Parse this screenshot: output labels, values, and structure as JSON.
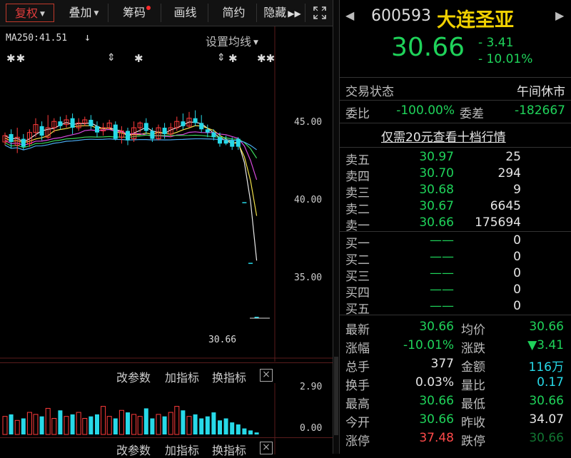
{
  "toolbar": {
    "fuquan": "复权",
    "diejia": "叠加",
    "chouma": "筹码",
    "huaxian": "画线",
    "jianyue": "简约",
    "yincang": "隐藏"
  },
  "chart": {
    "ma250": "MA250:41.51",
    "settings_label": "设置均线",
    "price_axis": [
      "45.00",
      "40.00",
      "35.00"
    ],
    "last_price_label": "30.66",
    "sub_axis": [
      "2.90",
      "0.00"
    ],
    "sub_toolbar": {
      "change_params": "改参数",
      "add_indicator": "加指标",
      "switch_indicator": "换指标"
    },
    "sub_toolbar2": {
      "change_params": "改参数",
      "add_indicator": "加指标",
      "switch_indicator": "换指标"
    },
    "candles": [
      {
        "o": 41.7,
        "c": 42.1,
        "h": 42.3,
        "l": 41.5,
        "up": true
      },
      {
        "o": 42.2,
        "c": 41.7,
        "h": 42.5,
        "l": 41.3,
        "up": false
      },
      {
        "o": 41.5,
        "c": 42.0,
        "h": 42.6,
        "l": 41.0,
        "up": true
      },
      {
        "o": 41.9,
        "c": 41.4,
        "h": 42.2,
        "l": 41.2,
        "up": false
      },
      {
        "o": 41.6,
        "c": 42.3,
        "h": 42.5,
        "l": 41.4,
        "up": true
      },
      {
        "o": 42.3,
        "c": 42.8,
        "h": 43.2,
        "l": 42.0,
        "up": true
      },
      {
        "o": 42.7,
        "c": 42.1,
        "h": 43.0,
        "l": 41.8,
        "up": false
      },
      {
        "o": 42.0,
        "c": 42.6,
        "h": 43.4,
        "l": 41.9,
        "up": true
      },
      {
        "o": 42.6,
        "c": 43.0,
        "h": 43.2,
        "l": 42.3,
        "up": true
      },
      {
        "o": 43.0,
        "c": 42.7,
        "h": 43.3,
        "l": 42.5,
        "up": false
      },
      {
        "o": 42.8,
        "c": 43.1,
        "h": 43.4,
        "l": 42.6,
        "up": true
      },
      {
        "o": 43.2,
        "c": 42.6,
        "h": 43.5,
        "l": 42.2,
        "up": false
      },
      {
        "o": 42.6,
        "c": 42.9,
        "h": 43.2,
        "l": 42.4,
        "up": true
      },
      {
        "o": 42.9,
        "c": 43.1,
        "h": 43.3,
        "l": 42.7,
        "up": true
      },
      {
        "o": 43.1,
        "c": 42.7,
        "h": 43.4,
        "l": 42.5,
        "up": false
      },
      {
        "o": 42.7,
        "c": 42.3,
        "h": 43.0,
        "l": 42.0,
        "up": false
      },
      {
        "o": 42.4,
        "c": 42.6,
        "h": 42.9,
        "l": 42.1,
        "up": true
      },
      {
        "o": 42.6,
        "c": 42.9,
        "h": 43.1,
        "l": 42.5,
        "up": true
      },
      {
        "o": 42.8,
        "c": 41.9,
        "h": 43.0,
        "l": 41.8,
        "up": false
      },
      {
        "o": 42.0,
        "c": 42.4,
        "h": 42.7,
        "l": 41.6,
        "up": true
      },
      {
        "o": 42.4,
        "c": 41.8,
        "h": 42.6,
        "l": 41.5,
        "up": false
      },
      {
        "o": 41.9,
        "c": 42.6,
        "h": 43.0,
        "l": 41.7,
        "up": true
      },
      {
        "o": 42.6,
        "c": 42.9,
        "h": 43.0,
        "l": 42.3,
        "up": true
      },
      {
        "o": 42.9,
        "c": 42.4,
        "h": 43.2,
        "l": 42.2,
        "up": false
      },
      {
        "o": 42.4,
        "c": 41.9,
        "h": 42.6,
        "l": 41.7,
        "up": false
      },
      {
        "o": 41.9,
        "c": 42.6,
        "h": 42.8,
        "l": 41.8,
        "up": true
      },
      {
        "o": 42.6,
        "c": 42.2,
        "h": 42.9,
        "l": 41.9,
        "up": false
      },
      {
        "o": 42.2,
        "c": 42.6,
        "h": 42.9,
        "l": 42.0,
        "up": true
      },
      {
        "o": 42.6,
        "c": 43.0,
        "h": 43.3,
        "l": 42.4,
        "up": true
      },
      {
        "o": 43.0,
        "c": 42.7,
        "h": 43.5,
        "l": 42.5,
        "up": false
      },
      {
        "o": 42.7,
        "c": 43.2,
        "h": 43.6,
        "l": 42.6,
        "up": true
      },
      {
        "o": 43.2,
        "c": 42.9,
        "h": 43.7,
        "l": 42.7,
        "up": false
      },
      {
        "o": 42.9,
        "c": 42.5,
        "h": 43.4,
        "l": 42.3,
        "up": false
      },
      {
        "o": 42.5,
        "c": 42.3,
        "h": 42.8,
        "l": 42.0,
        "up": false
      },
      {
        "o": 42.3,
        "c": 42.0,
        "h": 42.5,
        "l": 41.8,
        "up": false
      },
      {
        "o": 42.0,
        "c": 41.6,
        "h": 42.3,
        "l": 41.4,
        "up": false
      },
      {
        "o": 41.6,
        "c": 41.8,
        "h": 42.1,
        "l": 41.5,
        "up": false
      },
      {
        "o": 41.8,
        "c": 41.4,
        "h": 42.0,
        "l": 41.2,
        "up": false
      },
      {
        "o": 41.4,
        "c": 41.9,
        "h": 42.0,
        "l": 41.2,
        "up": false
      },
      {
        "o": 37.9,
        "c": 37.9,
        "h": 37.9,
        "l": 37.9,
        "up": false
      },
      {
        "o": 34.07,
        "c": 34.07,
        "h": 34.07,
        "l": 34.07,
        "up": false
      },
      {
        "o": 30.66,
        "c": 30.66,
        "h": 30.66,
        "l": 30.66,
        "up": false
      }
    ],
    "volumes": [
      0.9,
      1.0,
      0.7,
      0.8,
      1.1,
      1.0,
      0.9,
      1.3,
      0.8,
      1.2,
      0.9,
      1.0,
      1.1,
      0.8,
      0.9,
      1.0,
      1.4,
      0.9,
      0.8,
      1.2,
      1.1,
      1.0,
      0.9,
      1.3,
      0.8,
      1.0,
      0.9,
      1.1,
      1.4,
      1.2,
      0.9,
      1.0,
      0.8,
      0.9,
      1.1,
      0.7,
      0.8,
      0.6,
      0.5,
      0.3,
      0.2,
      0.1
    ],
    "colors": {
      "up": "#ff3b3b",
      "down": "#27d9e8"
    }
  },
  "quote": {
    "code": "600593",
    "name": "大连圣亚",
    "price": "30.66",
    "change": "- 3.41",
    "change_pct": "- 10.01%",
    "status_label": "交易状态",
    "status_value": "午间休市",
    "weibi_label": "委比",
    "weibi_value": "-100.00%",
    "weicha_label": "委差",
    "weicha_value": "-182667",
    "promo_link": "仅需20元查看十档行情",
    "sells": [
      {
        "label": "卖五",
        "price": "30.97",
        "vol": "25"
      },
      {
        "label": "卖四",
        "price": "30.70",
        "vol": "294"
      },
      {
        "label": "卖三",
        "price": "30.68",
        "vol": "9"
      },
      {
        "label": "卖二",
        "price": "30.67",
        "vol": "6645"
      },
      {
        "label": "卖一",
        "price": "30.66",
        "vol": "175694"
      }
    ],
    "buys": [
      {
        "label": "买一",
        "price": "——",
        "vol": "0"
      },
      {
        "label": "买二",
        "price": "——",
        "vol": "0"
      },
      {
        "label": "买三",
        "price": "——",
        "vol": "0"
      },
      {
        "label": "买四",
        "price": "——",
        "vol": "0"
      },
      {
        "label": "买五",
        "price": "——",
        "vol": "0"
      }
    ],
    "stats": {
      "zuixin_l": "最新",
      "zuixin_v": "30.66",
      "junjia_l": "均价",
      "junjia_v": "30.66",
      "zhangfu_l": "涨幅",
      "zhangfu_v": "-10.01%",
      "zhangdie_l": "涨跌",
      "zhangdie_v": "▼3.41",
      "zongshou_l": "总手",
      "zongshou_v": "377",
      "jine_l": "金额",
      "jine_v": "116万",
      "huanshou_l": "换手",
      "huanshou_v": "0.03%",
      "liangbi_l": "量比",
      "liangbi_v": "0.17",
      "zuigao_l": "最高",
      "zuigao_v": "30.66",
      "zuidi_l": "最低",
      "zuidi_v": "30.66",
      "jinkai_l": "今开",
      "jinkai_v": "30.66",
      "zuoshou_l": "昨收",
      "zuoshou_v": "34.07",
      "zhangting_l": "涨停",
      "zhangting_v": "37.48",
      "dieting_l": "跌停",
      "dieting_v": "30.66"
    }
  }
}
